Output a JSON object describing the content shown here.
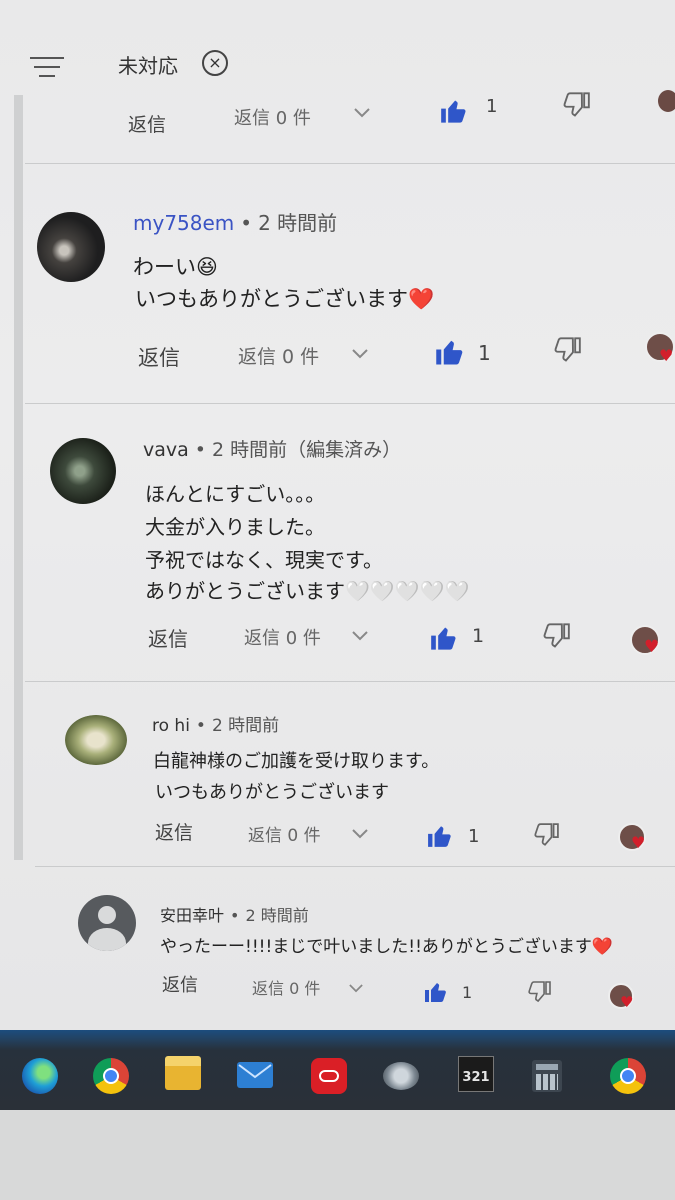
{
  "topbar": {
    "filter_label": "未対応",
    "close_icon": "×"
  },
  "partial_comment": {
    "reply_label": "返信",
    "reply_count": "返信 0 件",
    "like_count": "1"
  },
  "comments": [
    {
      "author": "my758em",
      "time": "2 時間前",
      "lines": [
        "わーい😆",
        "いつもありがとうございます❤️"
      ],
      "reply_label": "返信",
      "reply_count": "返信 0 件",
      "like_count": "1"
    },
    {
      "author": "vava",
      "time": "2 時間前（編集済み）",
      "lines": [
        "ほんとにすごい。。。",
        "大金が入りました。",
        "予祝ではなく、現実です。",
        "ありがとうございます🤍🤍🤍🤍🤍"
      ],
      "reply_label": "返信",
      "reply_count": "返信 0 件",
      "like_count": "1"
    },
    {
      "author": "ro hi",
      "time": "2 時間前",
      "lines": [
        "白龍神様のご加護を受け取ります。",
        "いつもありがとうございます"
      ],
      "reply_label": "返信",
      "reply_count": "返信 0 件",
      "like_count": "1"
    },
    {
      "author": "安田幸叶",
      "time": "2 時間前",
      "lines": [
        "やったーー!!!!まじで叶いました!!ありがとうございます❤️"
      ],
      "reply_label": "返信",
      "reply_count": "返信 0 件",
      "like_count": "1"
    }
  ],
  "taskbar": {
    "icons": [
      "edge-icon",
      "chrome-icon",
      "folder-icon",
      "mail-icon",
      "creative-cloud-icon",
      "gadget-icon",
      "video-editor-icon",
      "calculator-icon",
      "chrome-app-icon"
    ],
    "video_editor_label": "321"
  },
  "colors": {
    "like_blue": "#2f56c9",
    "link_blue": "#3a53c4",
    "heart_red": "#d21f2b"
  }
}
